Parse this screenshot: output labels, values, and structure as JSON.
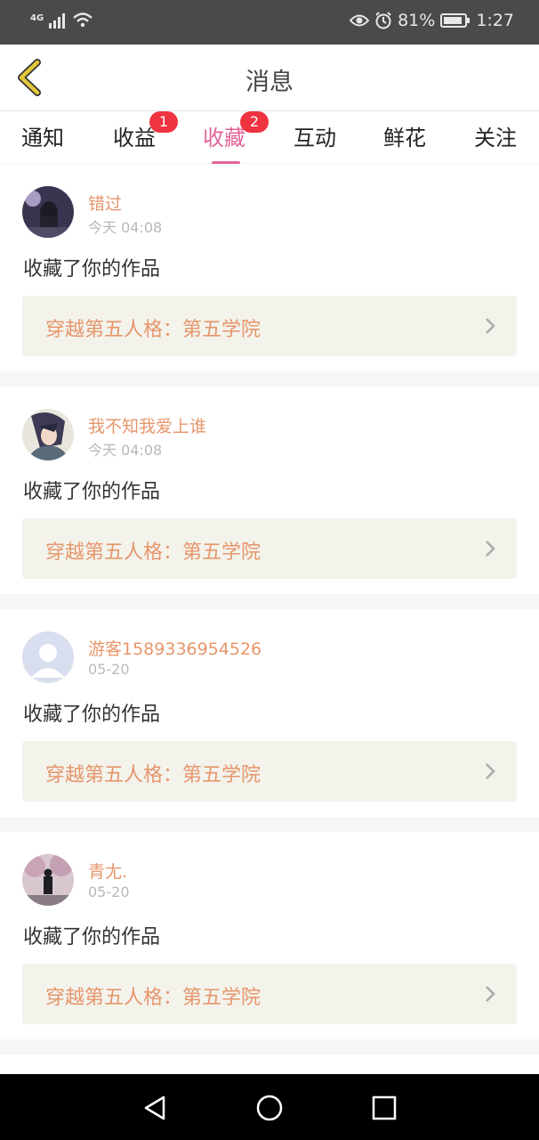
{
  "status_bar": {
    "network": "4G",
    "battery_percent": "81%",
    "time": "1:27",
    "icons": [
      "signal-icon",
      "wifi-icon",
      "eye-icon",
      "alarm-icon",
      "battery-icon"
    ]
  },
  "header": {
    "title": "消息",
    "back_icon": "back-arrow-icon"
  },
  "tabs": [
    {
      "label": "通知",
      "badge": ""
    },
    {
      "label": "收益",
      "badge": "1"
    },
    {
      "label": "收藏",
      "badge": "2",
      "active": true
    },
    {
      "label": "互动",
      "badge": ""
    },
    {
      "label": "鲜花",
      "badge": ""
    },
    {
      "label": "关注",
      "badge": ""
    }
  ],
  "messages": [
    {
      "user": "错过",
      "time": "今天 04:08",
      "action": "收藏了你的作品",
      "work": "穿越第五人格：第五学院"
    },
    {
      "user": "我不知我爱上谁",
      "time": "今天 04:08",
      "action": "收藏了你的作品",
      "work": "穿越第五人格：第五学院"
    },
    {
      "user": "游客1589336954526",
      "time": "05-20",
      "action": "收藏了你的作品",
      "work": "穿越第五人格：第五学院"
    },
    {
      "user": "青尢.",
      "time": "05-20",
      "action": "收藏了你的作品",
      "work": "穿越第五人格：第五学院"
    }
  ],
  "colors": {
    "accent": "#e0649a",
    "username": "#e6966b",
    "badge": "#ef3340",
    "back_arrow": "#e2c73a"
  },
  "nav_bar": {
    "icons": [
      "nav-back-icon",
      "nav-home-icon",
      "nav-recents-icon"
    ]
  }
}
